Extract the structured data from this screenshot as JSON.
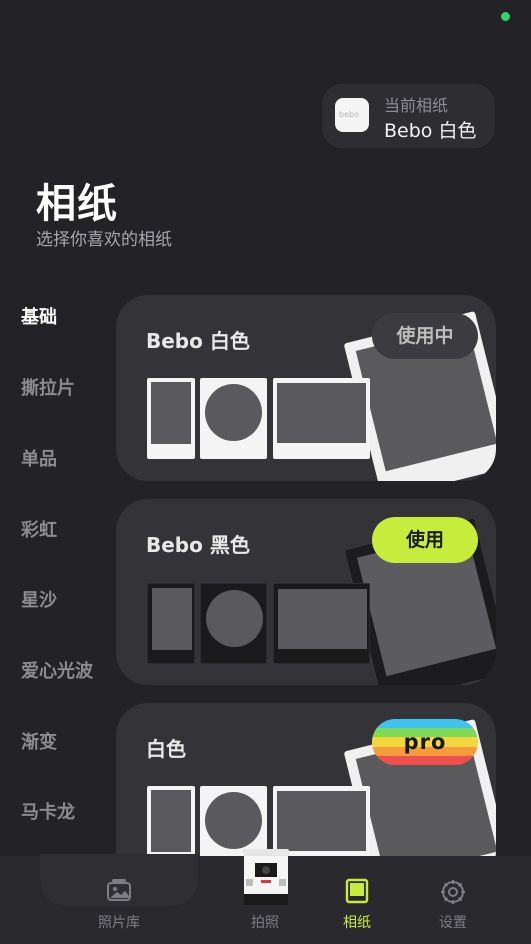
{
  "status": {
    "indicator_color": "#2fd66c"
  },
  "current_paper": {
    "label": "当前相纸",
    "value": "Bebo 白色",
    "thumb_text": "bebo"
  },
  "header": {
    "title": "相纸",
    "subtitle": "选择你喜欢的相纸"
  },
  "categories": [
    {
      "label": "基础",
      "active": true
    },
    {
      "label": "撕拉片",
      "active": false
    },
    {
      "label": "单品",
      "active": false
    },
    {
      "label": "彩虹",
      "active": false
    },
    {
      "label": "星沙",
      "active": false
    },
    {
      "label": "爱心光波",
      "active": false
    },
    {
      "label": "渐变",
      "active": false
    },
    {
      "label": "马卡龙",
      "active": false
    }
  ],
  "cards": [
    {
      "title": "Bebo 白色",
      "button": "使用中",
      "state": "in-use",
      "frame_color": "white"
    },
    {
      "title": "Bebo 黑色",
      "button": "使用",
      "state": "available",
      "frame_color": "black"
    },
    {
      "title": "白色",
      "button": "pro",
      "state": "pro",
      "frame_color": "white"
    }
  ],
  "pro_stripe_colors": [
    "#3ec3ef",
    "#7ed957",
    "#f5d63d",
    "#f59a3d",
    "#f0504d"
  ],
  "bottom_nav": [
    {
      "label": "照片库",
      "icon": "gallery-icon",
      "active": false
    },
    {
      "label": "拍照",
      "icon": "camera-icon",
      "active": false
    },
    {
      "label": "相纸",
      "icon": "paper-icon",
      "active": true
    },
    {
      "label": "设置",
      "icon": "settings-icon",
      "active": false
    }
  ],
  "accent_color": "#c7ec3c"
}
